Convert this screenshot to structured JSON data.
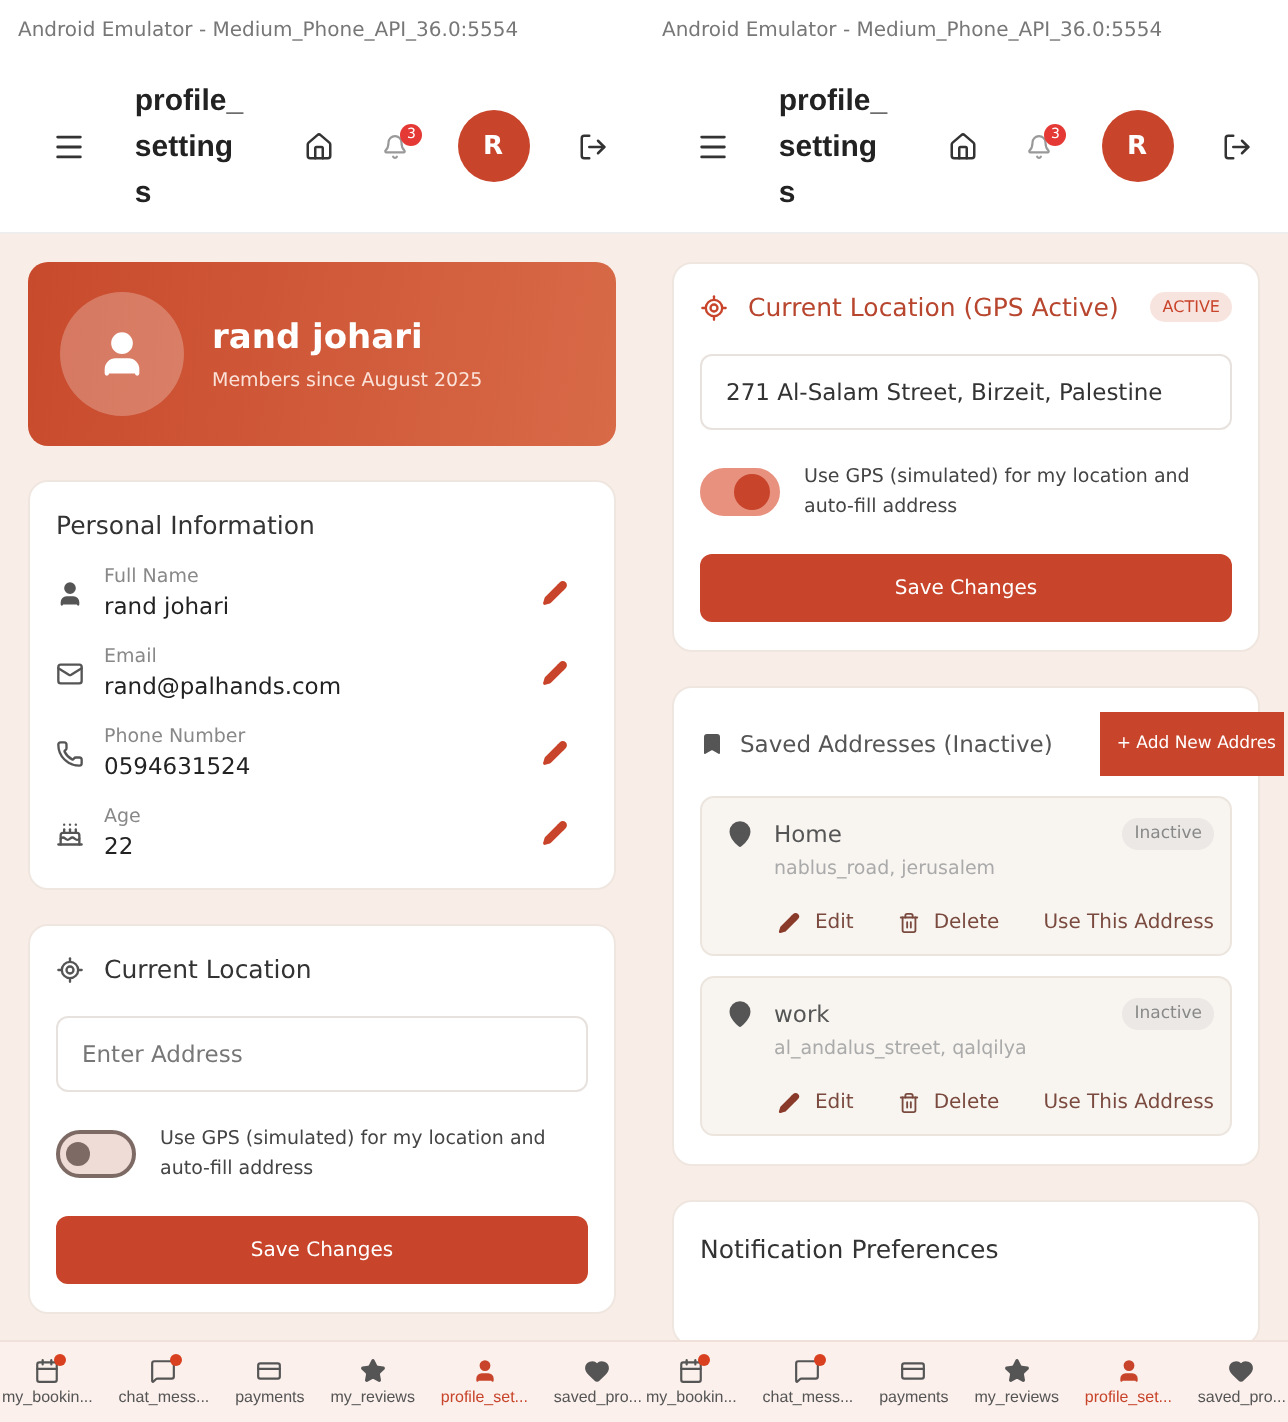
{
  "panes": [
    {
      "emulator_title": "Android Emulator - Medium_Phone_API_36.0:5554",
      "app_bar": {
        "title_lines": [
          "profile_",
          "setting",
          "s"
        ],
        "notification_count": "3",
        "avatar_initial": "R"
      },
      "sections": [
        {
          "kind": "profile",
          "name": "rand johari",
          "subtitle": "Members since August 2025"
        },
        {
          "kind": "info",
          "title": "Personal Information",
          "fields": [
            {
              "label": "Full Name",
              "value": "rand johari"
            },
            {
              "label": "Email",
              "value": "rand@palhands.com"
            },
            {
              "label": "Phone Number",
              "value": "0594631524"
            },
            {
              "label": "Age",
              "value": "22"
            }
          ]
        },
        {
          "kind": "location",
          "title": "Current Location",
          "active": false,
          "address": {
            "placeholder": "Enter Address"
          },
          "gps": {
            "on": false,
            "label": "Use GPS (simulated) for my location and auto-fill address"
          },
          "button": "Save Changes"
        }
      ],
      "nav": [
        {
          "label": "my_bookin...",
          "dot": true,
          "selected": false
        },
        {
          "label": "chat_mess...",
          "dot": true,
          "selected": false
        },
        {
          "label": "payments",
          "dot": false,
          "selected": false
        },
        {
          "label": "my_reviews",
          "dot": false,
          "selected": false
        },
        {
          "label": "profile_set...",
          "dot": false,
          "selected": true
        },
        {
          "label": "saved_pro...",
          "dot": false,
          "selected": false
        }
      ]
    },
    {
      "emulator_title": "Android Emulator - Medium_Phone_API_36.0:5554",
      "app_bar": {
        "title_lines": [
          "profile_",
          "setting",
          "s"
        ],
        "notification_count": "3",
        "avatar_initial": "R"
      },
      "sections": [
        {
          "kind": "location",
          "title": "Current Location (GPS Active)",
          "active": true,
          "badge": "ACTIVE",
          "address": {
            "value": "271 Al-Salam Street, Birzeit, Palestine"
          },
          "gps": {
            "on": true,
            "label": "Use GPS (simulated) for my location and auto-fill address"
          },
          "button": "Save Changes"
        },
        {
          "kind": "saved",
          "title": "Saved Addresses (Inactive)",
          "add_button": "+ Add New Addres",
          "addresses": [
            {
              "name": "Home",
              "address": "nablus_road, jerusalem",
              "status": "Inactive",
              "actions": [
                {
                  "kind": "edit",
                  "label": "Edit"
                },
                {
                  "kind": "delete",
                  "label": "Delete"
                },
                {
                  "kind": "use",
                  "label": "Use This Address"
                }
              ]
            },
            {
              "name": "work",
              "address": "al_andalus_street, qalqilya",
              "status": "Inactive",
              "actions": [
                {
                  "kind": "edit",
                  "label": "Edit"
                },
                {
                  "kind": "delete",
                  "label": "Delete"
                },
                {
                  "kind": "use",
                  "label": "Use This Address"
                }
              ]
            }
          ]
        },
        {
          "kind": "notifications",
          "title": "Notification Preferences"
        }
      ],
      "nav": [
        {
          "label": "my_bookin...",
          "dot": true,
          "selected": false
        },
        {
          "label": "chat_mess...",
          "dot": true,
          "selected": false
        },
        {
          "label": "payments",
          "dot": false,
          "selected": false
        },
        {
          "label": "my_reviews",
          "dot": false,
          "selected": false
        },
        {
          "label": "profile_set...",
          "dot": false,
          "selected": true
        },
        {
          "label": "saved_pro...",
          "dot": false,
          "selected": false
        }
      ]
    }
  ]
}
